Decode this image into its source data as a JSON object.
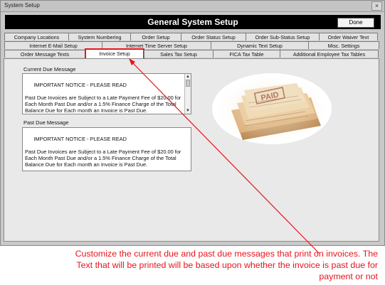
{
  "window": {
    "title": "System Setup",
    "close_glyph": "×"
  },
  "header": {
    "title": "General System Setup",
    "done_label": "Done"
  },
  "tabs_row1": [
    "Company Locations",
    "System Numbering",
    "Order Setup",
    "Order Status Setup",
    "Order Sub-Status Setup",
    "Order Waiver Text"
  ],
  "tabs_row2": [
    "Internet E-Mail Setup",
    "Internet Time Server Setup",
    "Dynamic Text Setup",
    "Misc. Settings"
  ],
  "tabs_row3": [
    "Order Message Texts",
    "Invoice Setup",
    "Sales Tax Setup",
    "FICA Tax Table",
    "Additional Employee Tax Tables"
  ],
  "active_tab": "Invoice Setup",
  "current_due": {
    "label": "Current Due Message",
    "text": "IMPORTANT NOTICE - PLEASE READ\n\nPast Due Invoices are Subject to a Late Payment Fee of $20.00 for Each Month Past Due and/or a 1.5% Finance Charge of the Total Balance Due for Each month an Invoice is Past Due."
  },
  "past_due": {
    "label": "Past Due Message",
    "text": "IMPORTANT NOTICE - PLEASE READ\n\nPast Due Invoices are Subject to a Late Payment Fee of $20.00 for Each Month Past Due and/or a 1.5% Finance Charge of the Total Balance Due for Each month an Invoice is Past Due."
  },
  "image": {
    "stamp_text": "PAID"
  },
  "annotation": "Customize the current due and past due messages that print on invoices.  The Text that will be printed will be based upon whether the invoice is past due for payment or not",
  "colors": {
    "annotation": "#e8141b",
    "header_bg": "#000000",
    "window_bg": "#c9c9c9"
  }
}
